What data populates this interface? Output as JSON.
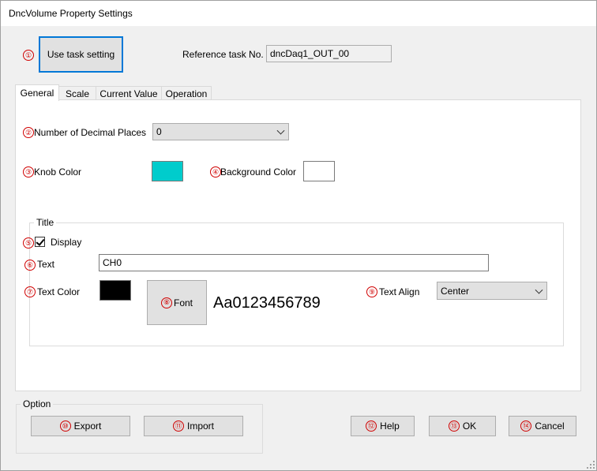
{
  "window": {
    "title": "DncVolume Property Settings"
  },
  "markers": [
    "①",
    "②",
    "③",
    "④",
    "⑤",
    "⑥",
    "⑦",
    "⑧",
    "⑨",
    "⑩",
    "⑪",
    "⑫",
    "⑬",
    "⑭"
  ],
  "task": {
    "use_task_setting_label": "Use task setting",
    "reference_label": "Reference task No.",
    "reference_value": "dncDaq1_OUT_00"
  },
  "tabs": [
    "General",
    "Scale",
    "Current Value",
    "Operation"
  ],
  "general": {
    "decimal_label": "Number of Decimal Places",
    "decimal_value": "0",
    "knob_color_label": "Knob Color",
    "knob_color": "#00cccc",
    "background_color_label": "Background Color",
    "background_color": "#ffffff"
  },
  "title_group": {
    "group_label": "Title",
    "display_label": "Display",
    "display_checked": true,
    "text_label": "Text",
    "text_value": "CH0",
    "text_color_label": "Text Color",
    "text_color": "#000000",
    "font_button_label": "Font",
    "font_preview": "Aa0123456789",
    "text_align_label": "Text Align",
    "text_align_value": "Center"
  },
  "option_group": {
    "group_label": "Option",
    "export_label": "Export",
    "import_label": "Import"
  },
  "footer": {
    "help_label": "Help",
    "ok_label": "OK",
    "cancel_label": "Cancel"
  }
}
